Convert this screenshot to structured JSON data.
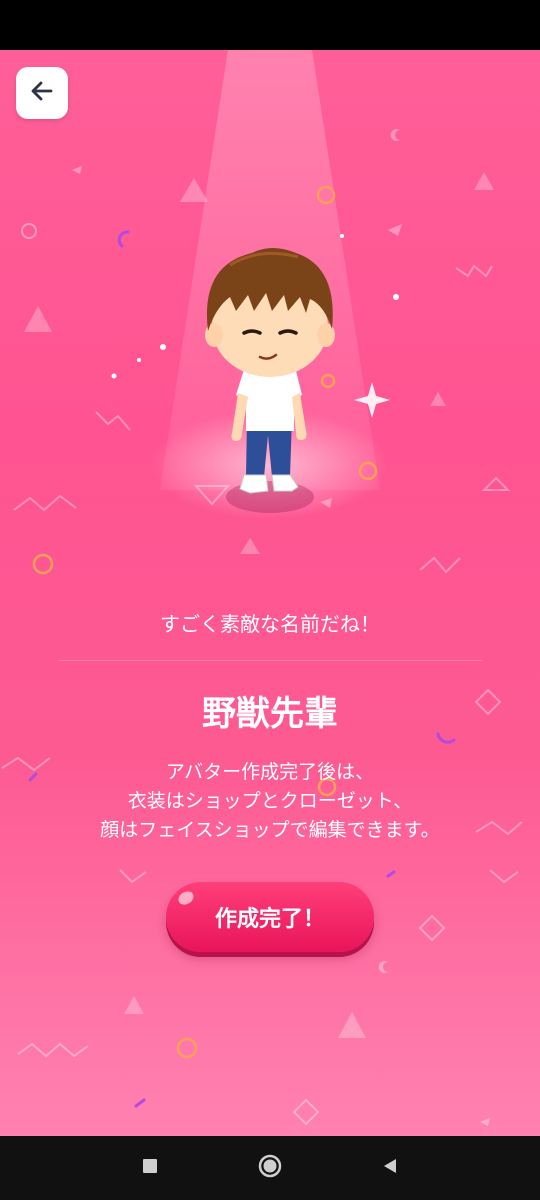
{
  "screen": {
    "compliment": "すごく素敵な名前だね！",
    "avatar_name": "野獣先輩",
    "info_lines": [
      "アバター作成完了後は、",
      "衣装はショップとクローゼット、",
      "顔はフェイスショップで編集できます。"
    ],
    "complete_label": "作成完了！"
  },
  "icons": {
    "back": "arrow-left-icon",
    "nav_recent": "square-icon",
    "nav_home": "circle-icon",
    "nav_back": "triangle-left-icon"
  },
  "colors": {
    "background": "#ff5a94",
    "button": "#ee1c5e",
    "text": "#ffffff"
  }
}
